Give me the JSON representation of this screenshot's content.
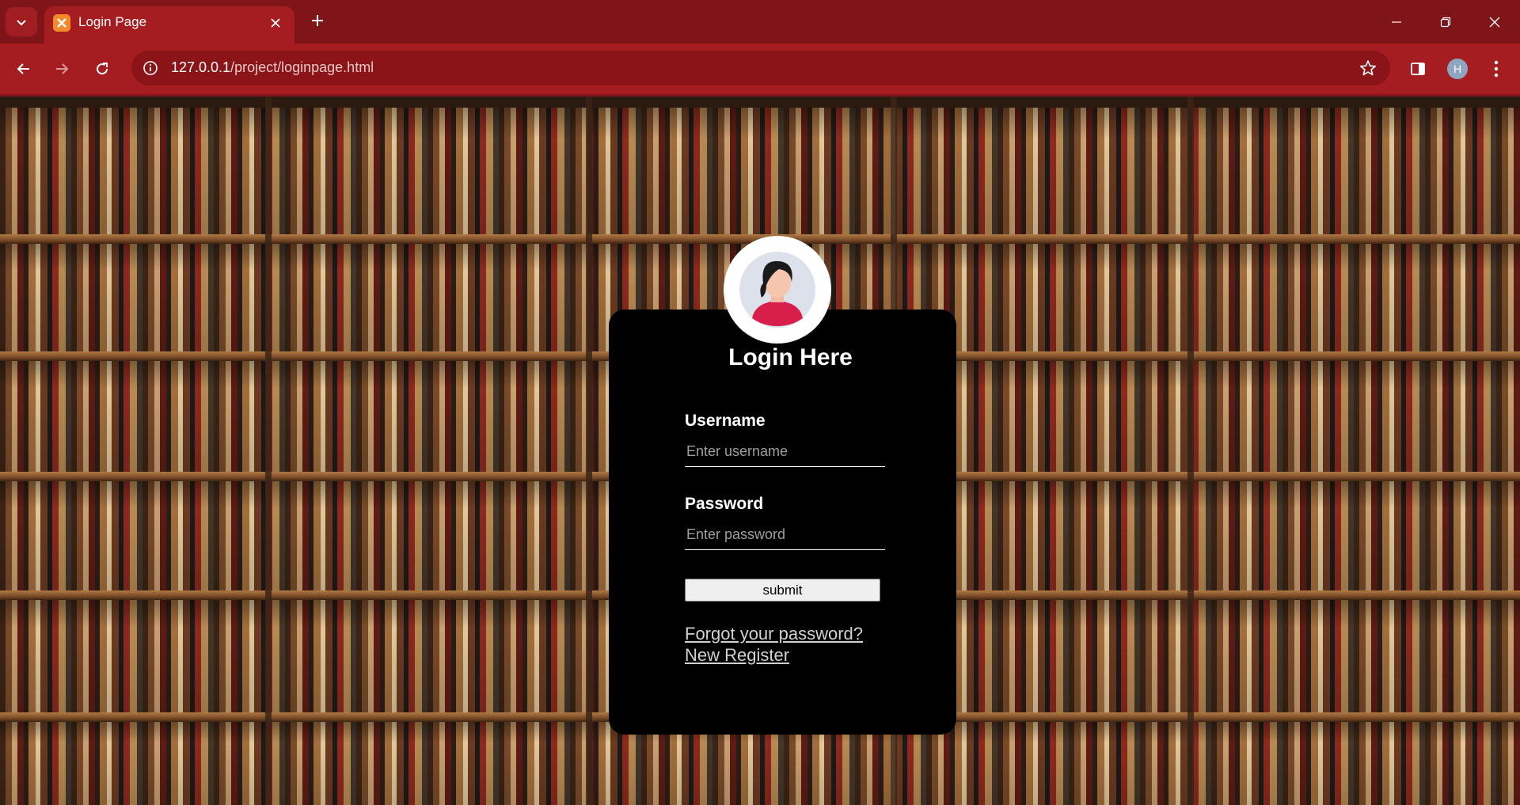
{
  "browser": {
    "tab_title": "Login Page",
    "url_host": "127.0.0.1",
    "url_path": "/project/loginpage.html",
    "profile_initial": "H",
    "accent_color": "#a51d21"
  },
  "login": {
    "title": "Login Here",
    "username_label": "Username",
    "username_placeholder": "Enter username",
    "password_label": "Password",
    "password_placeholder": "Enter password",
    "submit_label": "submit",
    "forgot_link": "Forgot your password?",
    "register_link": "New Register"
  },
  "icons": {
    "tab_list": "chevron-down-icon",
    "favicon": "xampp-icon",
    "tab_close": "close-icon",
    "new_tab": "plus-icon",
    "back": "arrow-left-icon",
    "forward": "arrow-right-icon",
    "reload": "reload-icon",
    "site_info": "info-icon",
    "bookmark": "star-icon",
    "side_panel": "side-panel-icon",
    "menu": "kebab-menu-icon",
    "avatar": "user-avatar-icon"
  }
}
